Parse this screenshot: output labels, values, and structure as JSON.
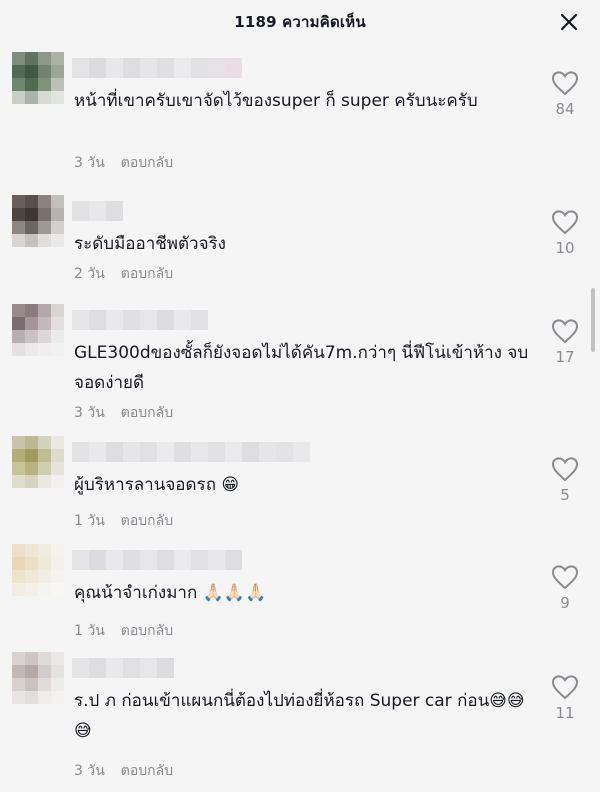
{
  "header": {
    "title": "1189 ความคิดเห็น",
    "close_icon": "close-icon"
  },
  "comments": [
    {
      "text": "หน้าที่เขาครับเขาจัดไว้ของsuper ก็ super ครับนะครับ",
      "time": "3 วัน",
      "reply": "ตอบกลับ",
      "likes": "84"
    },
    {
      "text": "ระดับมืออาชีพตัวจริง",
      "time": "2 วัน",
      "reply": "ตอบกลับ",
      "likes": "10"
    },
    {
      "text": "GLE300dของซั้ลก็ยังจอดไม่ได้คัน7m.กว่าๆ นี่ฟีโน่เข้าห้าง จบ จอดง่ายดี",
      "time": "3 วัน",
      "reply": "ตอบกลับ",
      "likes": "17"
    },
    {
      "text": "ผู้บริหารลานจอดรถ",
      "emoji": "😁",
      "time": "1 วัน",
      "reply": "ตอบกลับ",
      "likes": "5"
    },
    {
      "text": "คุณน้าจำเก่งมาก ",
      "emoji": "🙏🏻🙏🏻🙏🏻",
      "time": "1 วัน",
      "reply": "ตอบกลับ",
      "likes": "9"
    },
    {
      "text": "ร.ป ภ ก่อนเข้าแผนกนี่ต้องไปท่องยี่ห้อรถ Super car ก่อน",
      "emoji": "😅😅😅",
      "time": "3 วัน",
      "reply": "ตอบกลับ",
      "likes": "11"
    }
  ],
  "colors": {
    "background": "#f5f5f5",
    "text": "#161823",
    "muted": "#8a8b91"
  }
}
